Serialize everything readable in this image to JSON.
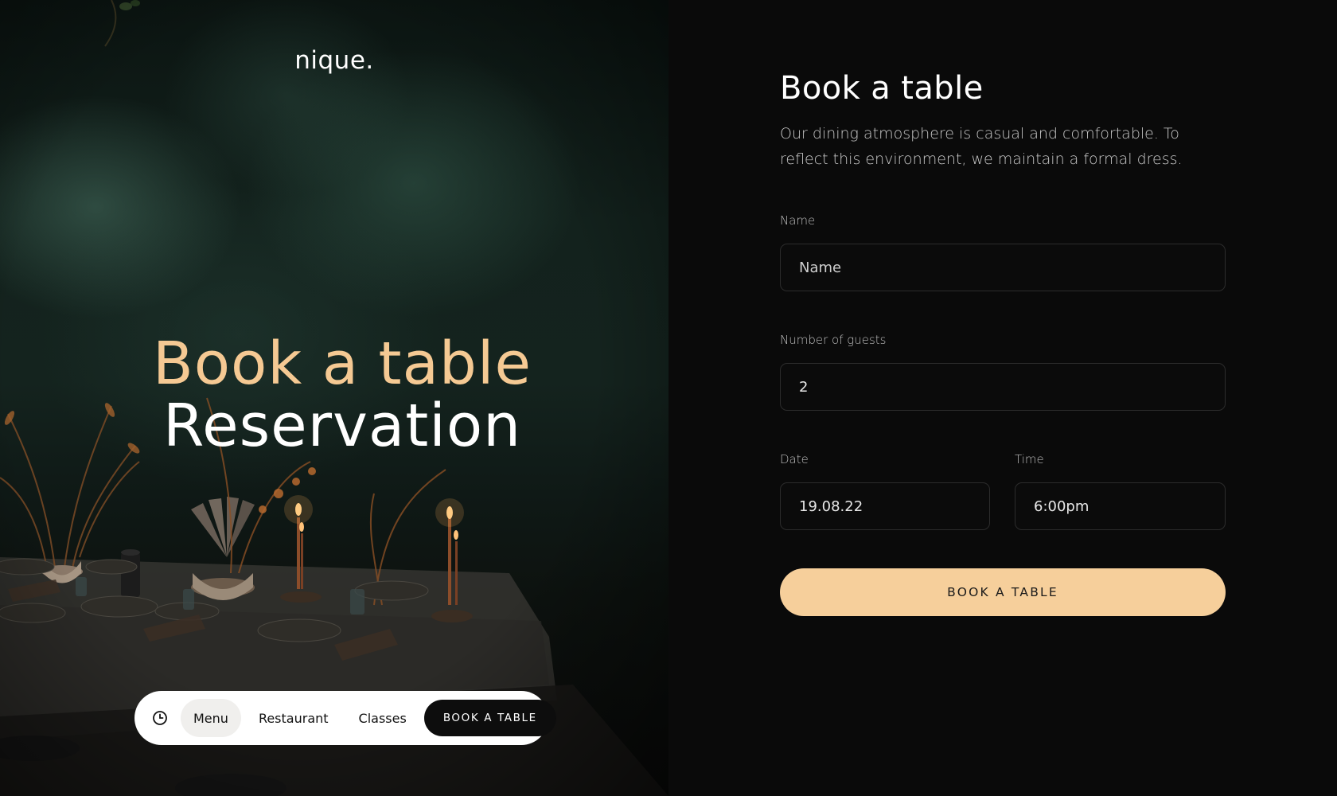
{
  "brand": {
    "logo": "nique.",
    "accent": "#f6cf9b",
    "headline_accent": "#f5c993"
  },
  "hero": {
    "title_line1": "Book a table",
    "title_line2": "Reservation"
  },
  "nav": {
    "clock_icon": "clock-icon",
    "items": [
      {
        "label": "Menu",
        "active": true
      },
      {
        "label": "Restaurant",
        "active": false
      },
      {
        "label": "Classes",
        "active": false
      }
    ],
    "cta": "BOOK A TABLE"
  },
  "form": {
    "title": "Book a table",
    "description": "Our dining atmosphere is casual and comfortable. To reflect this environment, we maintain a formal dress.",
    "fields": {
      "name": {
        "label": "Name",
        "placeholder": "Name",
        "value": ""
      },
      "guests": {
        "label": "Number of guests",
        "value": "2"
      },
      "date": {
        "label": "Date",
        "value": "19.08.22"
      },
      "time": {
        "label": "Time",
        "value": "6:00pm"
      }
    },
    "submit": "BOOK A TABLE"
  }
}
